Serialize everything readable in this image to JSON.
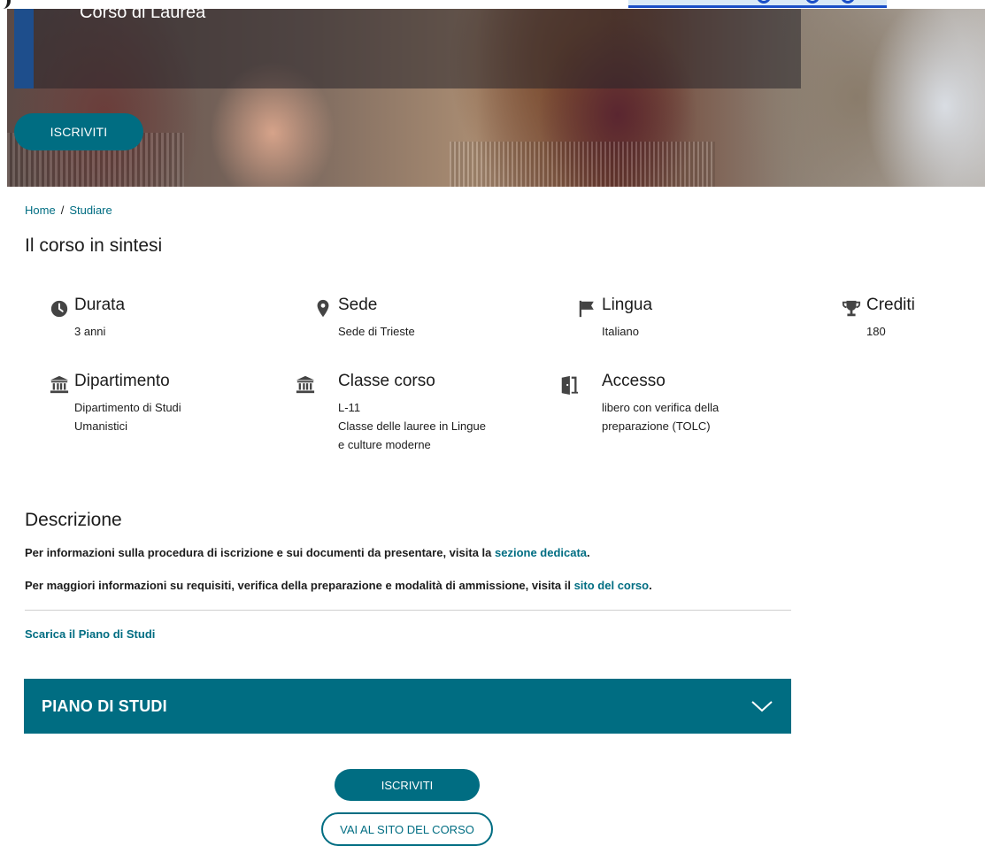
{
  "hero": {
    "subtitle": "Corso di Laurea",
    "enroll_label": "ISCRIVITI"
  },
  "breadcrumb": [
    "Home",
    "Studiare"
  ],
  "breadcrumb_separator": "/",
  "summary": {
    "title": "Il corso in sintesi",
    "items": [
      {
        "icon": "clock-icon",
        "label": "Durata",
        "value": "3 anni"
      },
      {
        "icon": "map-marker-icon",
        "label": "Sede",
        "value": "Sede di Trieste"
      },
      {
        "icon": "flag-icon",
        "label": "Lingua",
        "value": "Italiano"
      },
      {
        "icon": "trophy-icon",
        "label": "Crediti",
        "value": "180"
      },
      {
        "icon": "institution-icon",
        "label": "Dipartimento",
        "value_lines": [
          "Dipartimento di Studi",
          "Umanistici"
        ]
      },
      {
        "icon": "institution-icon",
        "label": "Classe corso",
        "value_lines": [
          "L-11",
          "Classe delle lauree in Lingue",
          "e culture moderne"
        ]
      },
      {
        "icon": "door-open-icon",
        "label": "Accesso",
        "value_lines": [
          "libero con verifica della",
          "preparazione (TOLC)"
        ]
      }
    ]
  },
  "description": {
    "title": "Descrizione",
    "p1_text": "Per informazioni sulla procedura di iscrizione e sui documenti da presentare, visita la ",
    "p1_link": "sezione dedicata",
    "p1_end": ".",
    "p2_text": "Per maggiori informazioni su requisiti, verifica della preparazione e modalità di ammissione, visita il ",
    "p2_link": "sito del corso",
    "p2_end": "."
  },
  "download_link": "Scarica il Piano di Studi",
  "accordion": {
    "title": "PIANO DI STUDI"
  },
  "actions": {
    "enroll_label": "ISCRIVITI",
    "site_label": "VAI AL SITO DEL CORSO"
  },
  "colors": {
    "accent": "#006d82",
    "text": "#1c1c1c",
    "icon": "#444444"
  }
}
